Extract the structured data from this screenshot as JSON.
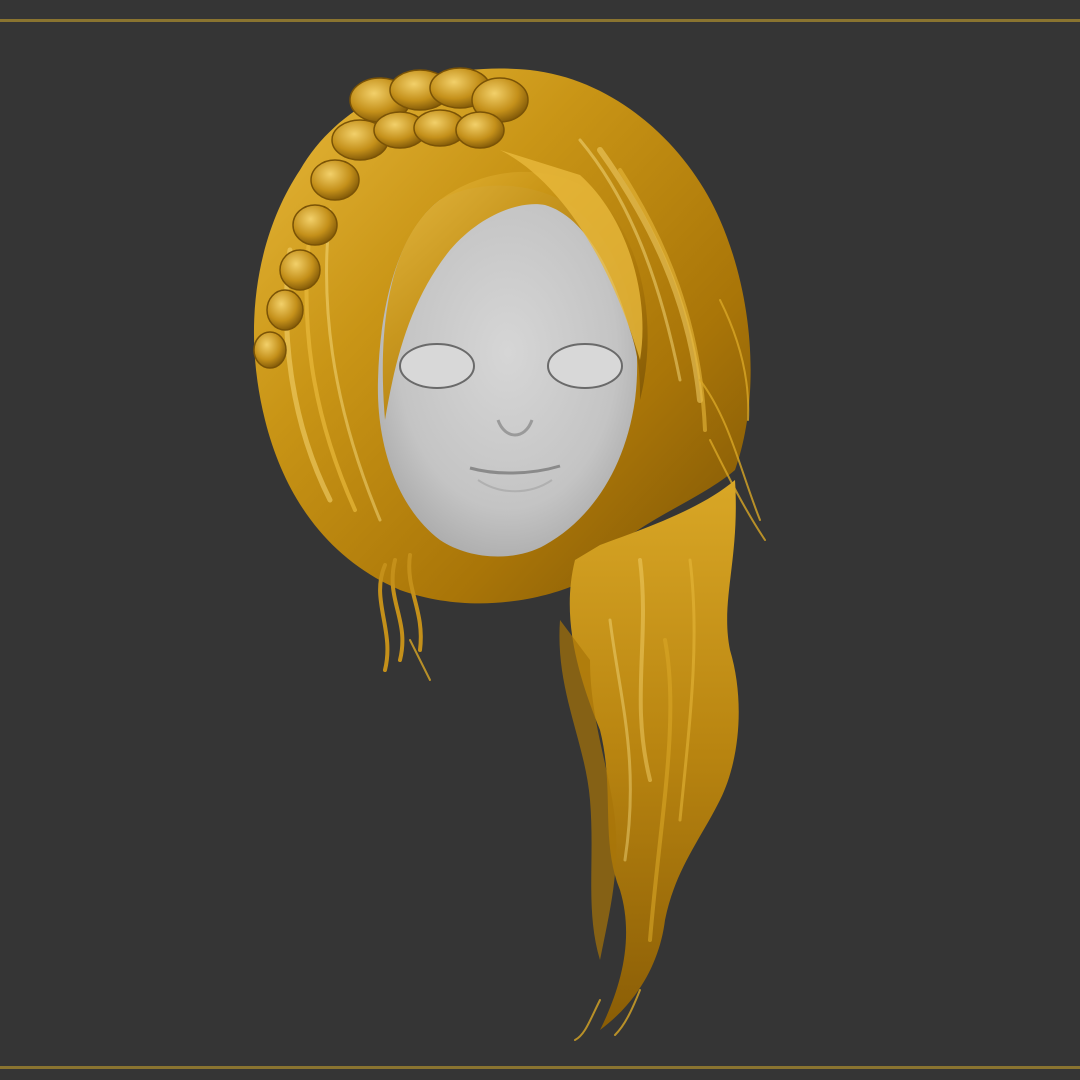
{
  "scene": {
    "background_color": "#353535",
    "border_color": "#8a7430",
    "hair_color_base": "#b8860b",
    "hair_color_highlight": "#f2d06a",
    "hair_color_shadow": "#6b4a08",
    "face_color": "#cfcfcf"
  }
}
